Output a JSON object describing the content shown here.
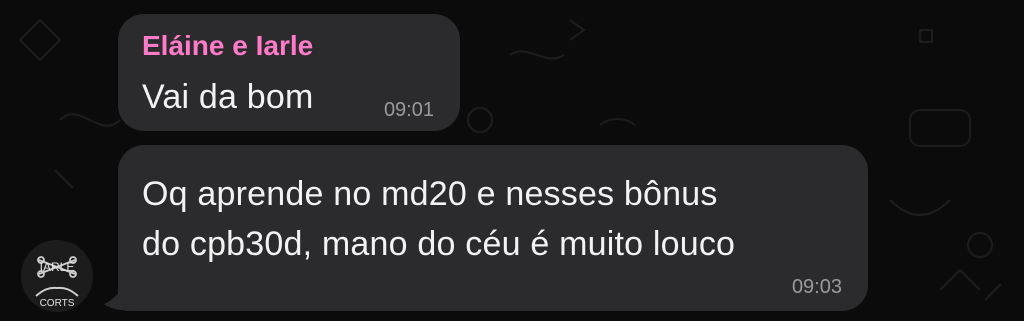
{
  "chat": {
    "messages": [
      {
        "sender": "Eláine e Iarle",
        "text": "Vai da bom",
        "time": "09:01"
      },
      {
        "text": "Oq aprende no md20 e nesses bônus\ndo cpb30d, mano do céu é muito louco",
        "time": "09:03"
      }
    ],
    "avatar": {
      "icon": "sticker-avatar-icon",
      "text_top": "IARLE",
      "text_bottom": "CORTS"
    }
  },
  "colors": {
    "background": "#0b0b0b",
    "bubble": "#2b2b2d",
    "sender": "#ff7ac8",
    "message_text": "#f2f2f2",
    "timestamp": "#9a9a9e"
  }
}
